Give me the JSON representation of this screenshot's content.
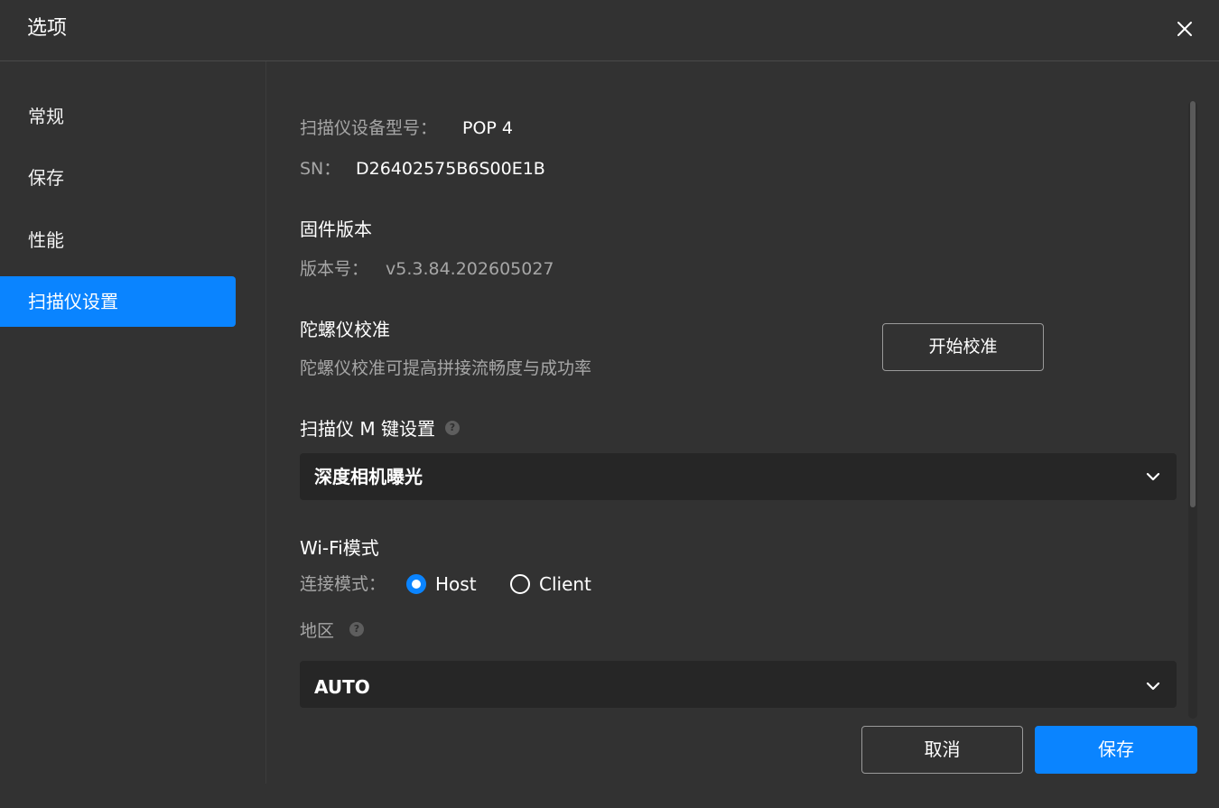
{
  "dialog": {
    "title": "选项"
  },
  "sidebar": {
    "items": [
      {
        "label": "常规",
        "active": false
      },
      {
        "label": "保存",
        "active": false
      },
      {
        "label": "性能",
        "active": false
      },
      {
        "label": "扫描仪设置",
        "active": true
      }
    ]
  },
  "scanner": {
    "model_label": "扫描仪设备型号：",
    "model_value": "POP 4",
    "sn_label": "SN：",
    "sn_value": "D26402575B6S00E1B"
  },
  "firmware": {
    "heading": "固件版本",
    "version_label": "版本号：",
    "version_value": "v5.3.84.202605027"
  },
  "gyro": {
    "heading": "陀螺仪校准",
    "description": "陀螺仪校准可提高拼接流畅度与成功率",
    "button_label": "开始校准"
  },
  "m_key": {
    "heading": "扫描仪 M 键设置",
    "help_glyph": "?",
    "selected": "深度相机曝光"
  },
  "wifi": {
    "heading": "Wi-Fi模式",
    "mode_label": "连接模式：",
    "options": [
      {
        "label": "Host",
        "checked": true
      },
      {
        "label": "Client",
        "checked": false
      }
    ],
    "region_label": "地区",
    "region_help_glyph": "?",
    "region_selected": "AUTO"
  },
  "footer": {
    "cancel_label": "取消",
    "save_label": "保存"
  },
  "colors": {
    "accent": "#0a84ff",
    "background": "#323232",
    "select_bg": "#262626"
  }
}
